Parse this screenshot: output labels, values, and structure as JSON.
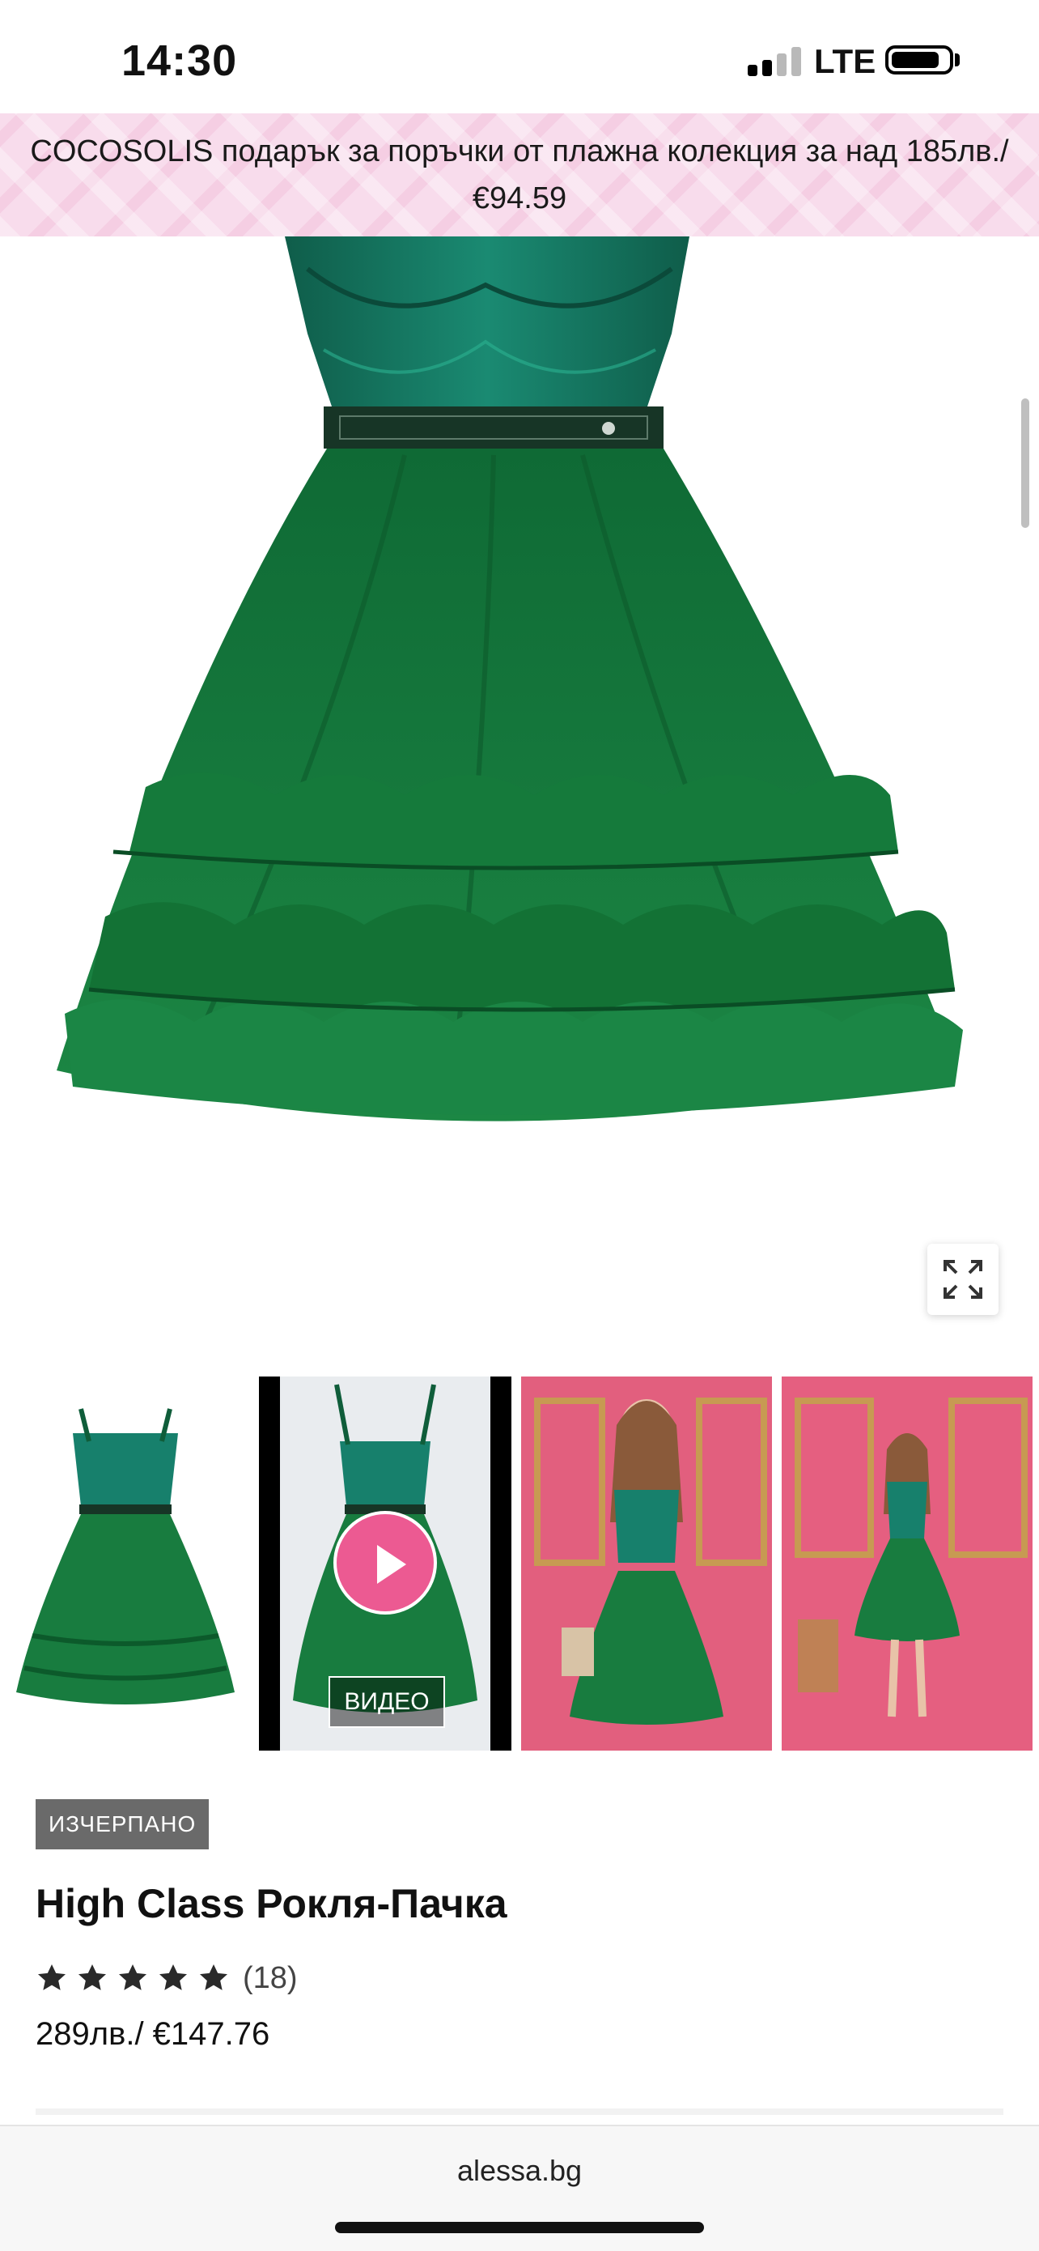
{
  "status_bar": {
    "time": "14:30",
    "network": "LTE",
    "battery_level": 0.8
  },
  "promo": {
    "text": "COCOSOLIS подарък за поръчки от плажна колекция за над 185лв./ €94.59"
  },
  "gallery": {
    "expand_icon": "expand-icon",
    "thumbnails": [
      {
        "alt": "dress-front-view"
      },
      {
        "alt": "dress-video",
        "video_label": "ВИДЕО"
      },
      {
        "alt": "model-wearing-dress"
      },
      {
        "alt": "model-full-length"
      }
    ]
  },
  "product": {
    "badge": "ИЗЧЕРПАНО",
    "title": "High Class Рокля-Пачка",
    "rating_stars": 5,
    "review_count": "(18)",
    "price": "289лв./ €147.76"
  },
  "browser": {
    "url": "alessa.bg"
  },
  "colors": {
    "dress_green": "#1d7a3e",
    "promo_pink": "#f8dcec",
    "play_pink": "#ec5a92",
    "badge_gray": "#6a6a6a"
  }
}
